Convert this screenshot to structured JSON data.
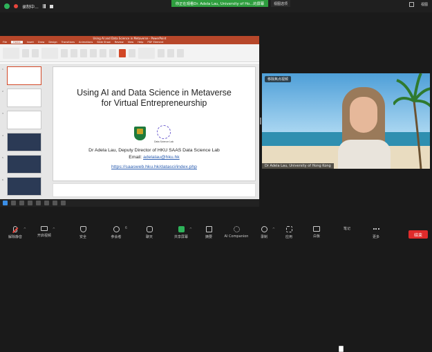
{
  "topbar": {
    "recording_label": "录制中...",
    "share_banner": "你正在观看Dr. Adela Lau, University of Ho...的屏幕",
    "view_options": "视图选项",
    "view_button": "视图"
  },
  "ppt": {
    "window_title": "Using AI and Data Science in Metaverse - PowerPoint",
    "tabs": [
      "File",
      "Home",
      "Insert",
      "Draw",
      "Design",
      "Transitions",
      "Animations",
      "Slide Show",
      "Review",
      "View",
      "Help",
      "PDF Element"
    ],
    "active_tab": "Home",
    "slide_numbers": [
      "1",
      "2",
      "3",
      "4",
      "5",
      "6"
    ],
    "slide": {
      "title_line1": "Using AI and Data Science in Metaverse",
      "title_line2": "for Virtual Entrepreneurship",
      "dsl_logo_text": "Data Science Lab",
      "presenter": "Dr Adela Lau, Deputy Director of HKU SAAS Data Science Lab",
      "email_label": "Email: ",
      "email": "adelalau@hku.hk",
      "url": "https://saasweb.hku.hk/datasci/index.php"
    },
    "status": "Slide 1 of 22"
  },
  "video": {
    "focus_tag": "移除焦点视频",
    "name": "Dr Adela Lau, University of Hong Kong"
  },
  "toolbar": {
    "items": [
      {
        "label": "解除静音",
        "icon": "muted-mic-icon"
      },
      {
        "label": "开启视频",
        "icon": "camera-off-icon"
      },
      {
        "label": "安全",
        "icon": "security-shield-icon"
      },
      {
        "label": "参会者",
        "icon": "participants-icon",
        "count": "6"
      },
      {
        "label": "聊天",
        "icon": "chat-icon"
      },
      {
        "label": "共享屏幕",
        "icon": "share-screen-icon"
      },
      {
        "label": "摘要",
        "icon": "summary-icon"
      },
      {
        "label": "AI Companion",
        "icon": "ai-companion-icon"
      },
      {
        "label": "录制",
        "icon": "record-icon"
      },
      {
        "label": "应用",
        "icon": "apps-icon"
      },
      {
        "label": "白板",
        "icon": "whiteboard-icon"
      },
      {
        "label": "笔记",
        "icon": "notes-icon"
      },
      {
        "label": "更多",
        "icon": "more-icon"
      }
    ],
    "end_label": "结束"
  },
  "colors": {
    "share_banner": "#2e9e3e",
    "ppt_accent": "#b7472a",
    "end_button": "#e02b2b"
  }
}
